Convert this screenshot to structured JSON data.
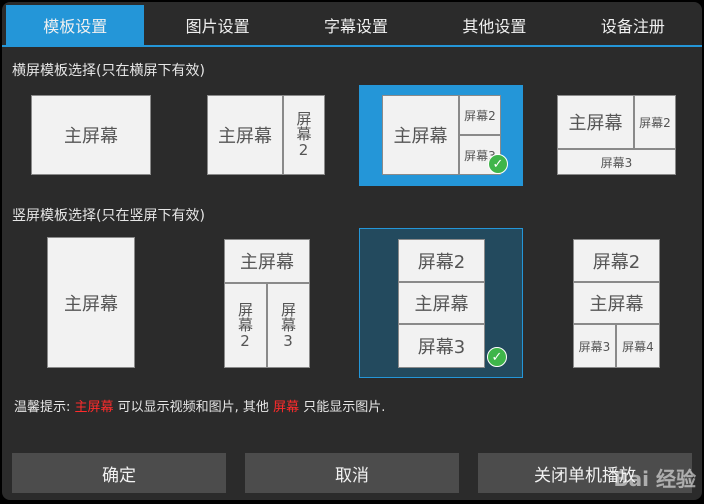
{
  "tabs": [
    {
      "label": "模板设置",
      "active": true
    },
    {
      "label": "图片设置",
      "active": false
    },
    {
      "label": "字幕设置",
      "active": false
    },
    {
      "label": "其他设置",
      "active": false
    },
    {
      "label": "设备注册",
      "active": false
    }
  ],
  "landscape": {
    "label": "横屏模板选择(只在横屏下有效)",
    "t1": {
      "main": "主屏幕"
    },
    "t2": {
      "main": "主屏幕",
      "s2": "屏幕2"
    },
    "t3": {
      "main": "主屏幕",
      "s2": "屏幕2",
      "s3": "屏幕3"
    },
    "t4": {
      "main": "主屏幕",
      "s2": "屏幕2",
      "s3": "屏幕3"
    }
  },
  "portrait": {
    "label": "竖屏模板选择(只在竖屏下有效)",
    "t1": {
      "main": "主屏幕"
    },
    "t2": {
      "main": "主屏幕",
      "s2": "屏幕2",
      "s3": "屏幕3"
    },
    "t3": {
      "main": "主屏幕",
      "s2": "屏幕2",
      "s3": "屏幕3"
    },
    "t4": {
      "main": "主屏幕",
      "s2": "屏幕2",
      "s3": "屏幕3",
      "s4": "屏幕4"
    }
  },
  "tip": {
    "prefix": "温馨提示: ",
    "main": "主屏幕",
    "middle": " 可以显示视频和图片, 其他 ",
    "other": "屏幕",
    "suffix": " 只能显示图片."
  },
  "buttons": {
    "ok": "确定",
    "cancel": "取消",
    "close": "关闭单机播放"
  },
  "watermark": "Bai 经验",
  "colors": {
    "accent": "#2496d8",
    "selected_portrait": "#234a5e",
    "check": "#3fb54a",
    "highlight": "#ff2b2b"
  }
}
